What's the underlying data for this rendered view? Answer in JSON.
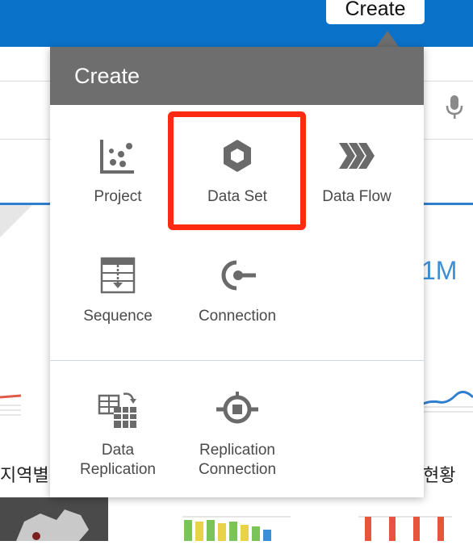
{
  "app": {
    "create_button_label": "Create",
    "kpi_value": "1M",
    "bg_label_left": "지역별",
    "bg_label_right": "현황"
  },
  "popover": {
    "title": "Create",
    "items": [
      {
        "label": "Project",
        "icon": "project-scatter-icon"
      },
      {
        "label": "Data Set",
        "icon": "hexagon-dataset-icon",
        "highlighted": true
      },
      {
        "label": "Data Flow",
        "icon": "chevrons-dataflow-icon"
      },
      {
        "label": "Sequence",
        "icon": "sequence-icon"
      },
      {
        "label": "Connection",
        "icon": "plug-connection-icon"
      },
      {
        "label": "Data\nReplication",
        "icon": "data-replication-icon"
      },
      {
        "label": "Replication\nConnection",
        "icon": "replication-connection-icon"
      }
    ]
  },
  "colors": {
    "topbar": "#0a72c9",
    "popover_header": "#6e6e6e",
    "highlight": "#ff2a12",
    "kpi": "#3b8fd6"
  }
}
